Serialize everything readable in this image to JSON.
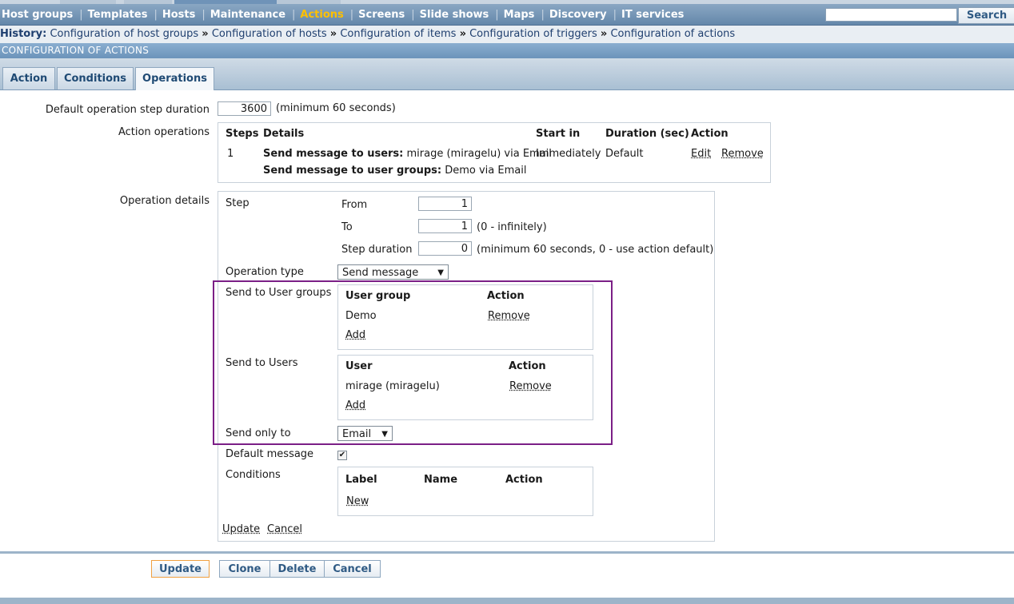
{
  "nav": {
    "items": [
      "Host groups",
      "Templates",
      "Hosts",
      "Maintenance",
      "Actions",
      "Screens",
      "Slide shows",
      "Maps",
      "Discovery",
      "IT services"
    ],
    "active": "Actions",
    "search_label": "Search"
  },
  "history": {
    "label": "History:",
    "items": [
      "Configuration of host groups",
      "Configuration of hosts",
      "Configuration of items",
      "Configuration of triggers",
      "Configuration of actions"
    ],
    "sep": "»"
  },
  "section_title": "CONFIGURATION OF ACTIONS",
  "tabs": [
    "Action",
    "Conditions",
    "Operations"
  ],
  "form": {
    "default_step_duration_label": "Default operation step duration",
    "default_step_duration_value": "3600",
    "default_step_duration_hint": "(minimum 60 seconds)",
    "action_operations_label": "Action operations",
    "ops_table": {
      "headers": [
        "Steps",
        "Details",
        "Start in",
        "Duration (sec)",
        "Action"
      ],
      "row": {
        "step": "1",
        "detail1_bold": "Send message to users:",
        "detail1_rest": "mirage (miragelu) via Email",
        "detail2_bold": "Send message to user groups:",
        "detail2_rest": "Demo via Email",
        "start_in": "Immediately",
        "duration": "Default",
        "edit": "Edit",
        "remove": "Remove"
      }
    },
    "operation_details_label": "Operation details",
    "step_label": "Step",
    "from_label": "From",
    "from_value": "1",
    "to_label": "To",
    "to_value": "1",
    "to_hint": "(0 - infinitely)",
    "step_duration_label": "Step duration",
    "step_duration_value": "0",
    "step_duration_hint": "(minimum 60 seconds, 0 - use action default)",
    "operation_type_label": "Operation type",
    "operation_type_value": "Send message",
    "send_to_groups_label": "Send to User groups",
    "groups_table": {
      "col1": "User group",
      "col2": "Action",
      "value": "Demo",
      "remove": "Remove",
      "add": "Add"
    },
    "send_to_users_label": "Send to Users",
    "users_table": {
      "col1": "User",
      "col2": "Action",
      "value": "mirage (miragelu)",
      "remove": "Remove",
      "add": "Add"
    },
    "send_only_to_label": "Send only to",
    "send_only_to_value": "Email",
    "default_message_label": "Default message",
    "default_message_checked": "✔",
    "conditions_label": "Conditions",
    "conditions_table": {
      "col1": "Label",
      "col2": "Name",
      "col3": "Action",
      "new": "New"
    },
    "update_link": "Update",
    "cancel_link": "Cancel"
  },
  "buttons": {
    "update": "Update",
    "clone": "Clone",
    "delete": "Delete",
    "cancel": "Cancel"
  },
  "colors": {
    "highlight": "#7b1f86",
    "active_nav": "#ffc000"
  }
}
